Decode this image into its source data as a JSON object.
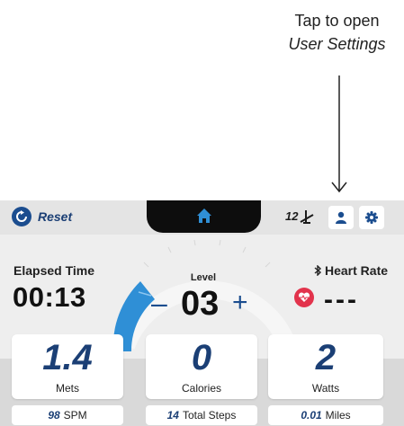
{
  "callout": {
    "line1": "Tap to open",
    "line2": "User Settings"
  },
  "topbar": {
    "reset_label": "Reset",
    "incline_value": "12",
    "icons": [
      "reset-icon",
      "home-icon",
      "incline-icon",
      "user-icon",
      "gear-icon"
    ]
  },
  "main": {
    "elapsed_label": "Elapsed Time",
    "elapsed_value": "00:13",
    "level_label": "Level",
    "level_value": "03",
    "minus": "–",
    "plus": "+",
    "heart_rate_label": "Heart Rate",
    "heart_rate_value": "---"
  },
  "tiles": [
    {
      "value": "1.4",
      "label": "Mets"
    },
    {
      "value": "0",
      "label": "Calories"
    },
    {
      "value": "2",
      "label": "Watts"
    }
  ],
  "stats": [
    {
      "value": "98",
      "label": "SPM"
    },
    {
      "value": "14",
      "label": "Total Steps"
    },
    {
      "value": "0.01",
      "label": "Miles"
    }
  ],
  "colors": {
    "accent": "#1b4d8f",
    "heart": "#e2334c",
    "arc_fill": "#2f8fd6",
    "dark_tab": "#0d0d0d"
  }
}
